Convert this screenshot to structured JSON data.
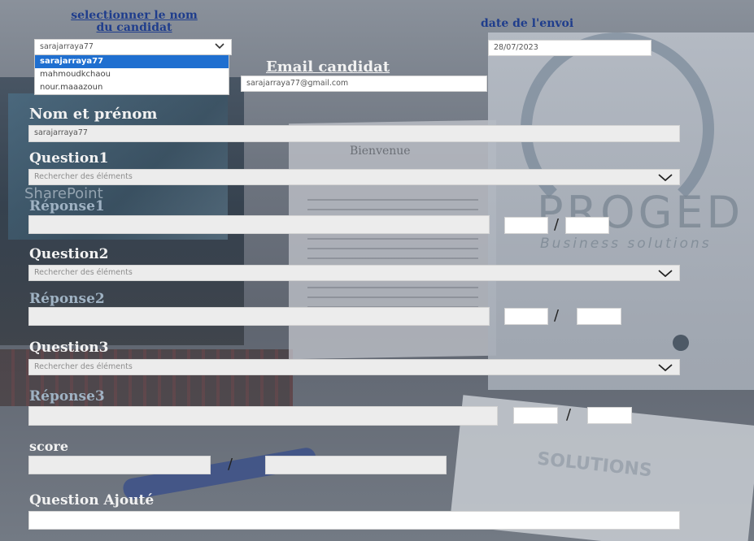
{
  "candidate_select": {
    "label": "selectionner le nom du candidat",
    "label_line1": "selectionner le nom",
    "label_line2": "du candidat",
    "value": "sarajarraya77",
    "options": [
      "sarajarraya77",
      "mahmoudkchaou",
      "nour.maaazoun"
    ]
  },
  "send_date": {
    "label": "date de l'envoi",
    "value": "28/07/2023"
  },
  "email": {
    "label": "Email candidat",
    "value": "sarajarraya77@gmail.com"
  },
  "full_name": {
    "label": "Nom et prénom",
    "value": "sarajarraya77"
  },
  "questions": [
    {
      "label": "Question1",
      "placeholder": "Rechercher des éléments",
      "answer_label": "Réponse1"
    },
    {
      "label": "Question2",
      "placeholder": "Rechercher des éléments",
      "answer_label": "Réponse2"
    },
    {
      "label": "Question3",
      "placeholder": "Rechercher des éléments",
      "answer_label": "Réponse3"
    }
  ],
  "fraction_separator": "/",
  "score": {
    "label": "score"
  },
  "added_question": {
    "label": "Question Ajouté"
  },
  "background": {
    "bienvenue": "Bienvenue",
    "sharepoint": "SharePoint",
    "brand": "PROGED",
    "brand_sub": "Business solutions",
    "brand_book": "SOLUTIONS"
  },
  "colors": {
    "selected_option": "#1f6fd0",
    "top_label": "#1f3d8c",
    "label": "#f2f2f2"
  }
}
